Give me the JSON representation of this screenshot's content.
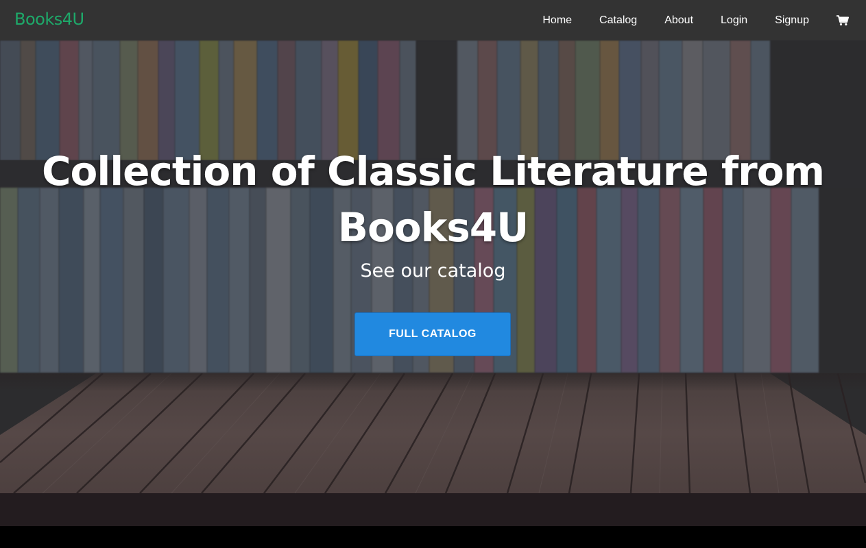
{
  "navbar": {
    "brand": "Books4U",
    "links": [
      {
        "label": "Home"
      },
      {
        "label": "Catalog"
      },
      {
        "label": "About"
      },
      {
        "label": "Login"
      },
      {
        "label": "Signup"
      }
    ],
    "cart_icon": "shopping-cart-icon"
  },
  "hero": {
    "title": "Collection of Classic Literature from Books4U",
    "subtitle": "See our catalog",
    "cta_label": "FULL CATALOG"
  },
  "colors": {
    "navbar_bg": "#333333",
    "brand": "#1ea96a",
    "cta_bg": "#2189e0",
    "footer_band": "#231c1f"
  }
}
